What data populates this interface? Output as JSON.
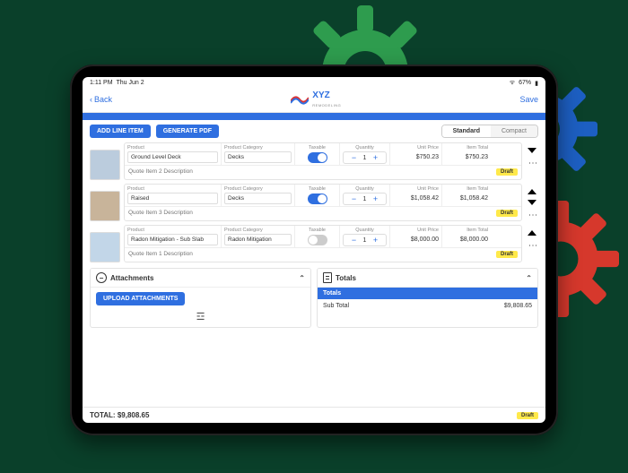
{
  "statusbar": {
    "time": "1:11 PM",
    "date": "Thu Jun 2",
    "battery": "67%"
  },
  "header": {
    "back": "Back",
    "save": "Save",
    "brand": "XYZ",
    "brand_sub": "REMODELING"
  },
  "toolbar": {
    "add_line_item": "ADD LINE ITEM",
    "generate_pdf": "GENERATE PDF",
    "seg_standard": "Standard",
    "seg_compact": "Compact"
  },
  "labels": {
    "product": "Product",
    "category": "Product Category",
    "taxable": "Taxable",
    "quantity": "Quantity",
    "unit_price": "Unit Price",
    "item_total": "Item Total",
    "draft": "Draft"
  },
  "items": [
    {
      "product": "Ground Level Deck",
      "category": "Decks",
      "taxable": true,
      "qty": "1",
      "unit_price": "$750.23",
      "item_total": "$750.23",
      "desc_placeholder": "Quote Item 2 Description"
    },
    {
      "product": "Raised",
      "category": "Decks",
      "taxable": true,
      "qty": "1",
      "unit_price": "$1,058.42",
      "item_total": "$1,058.42",
      "desc_placeholder": "Quote Item 3 Description"
    },
    {
      "product": "Radon Mitigation - Sub Slab",
      "category": "Radon Mitigation",
      "taxable": false,
      "qty": "1",
      "unit_price": "$8,000.00",
      "item_total": "$8,000.00",
      "desc_placeholder": "Quote Item 1 Description"
    }
  ],
  "attachments": {
    "title": "Attachments",
    "upload": "UPLOAD ATTACHMENTS"
  },
  "totals": {
    "title": "Totals",
    "bar": "Totals",
    "subtotal_label": "Sub Total",
    "subtotal_value": "$9,808.65"
  },
  "footer": {
    "total_label": "TOTAL:",
    "total_value": "$9,808.65",
    "draft": "Draft"
  }
}
